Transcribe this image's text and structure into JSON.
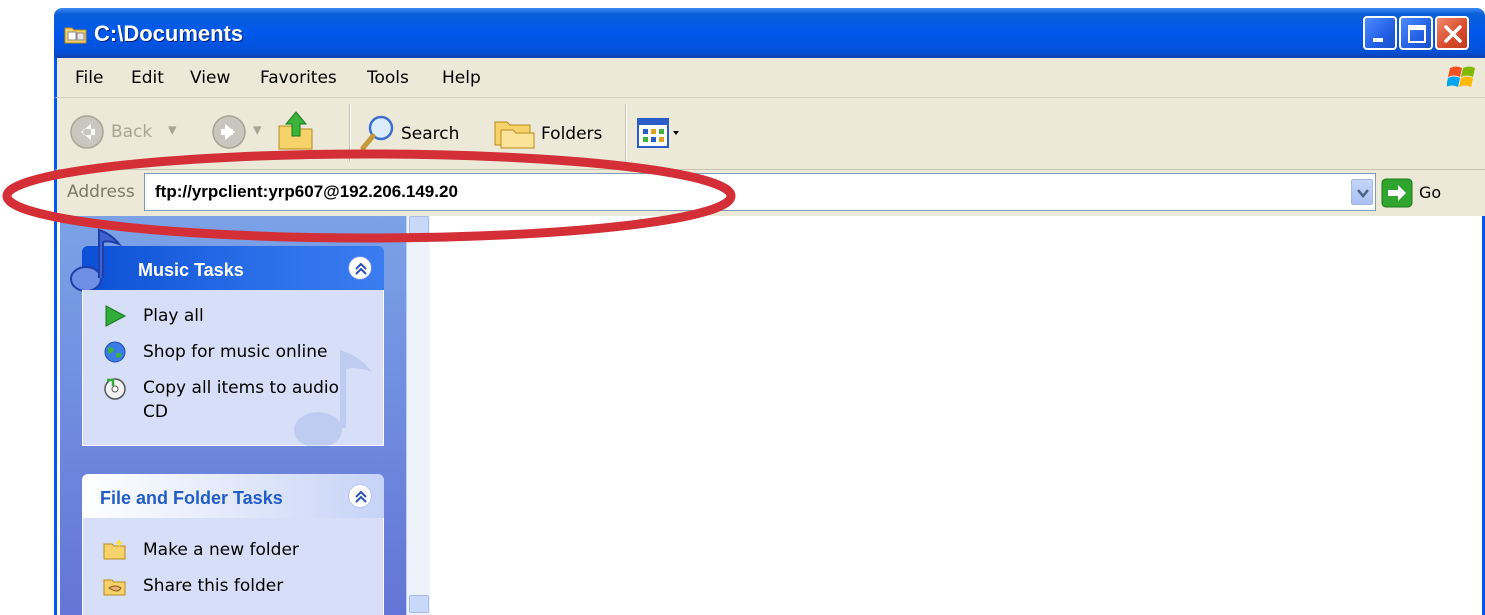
{
  "window": {
    "title": "C:\\Documents"
  },
  "menu": [
    "File",
    "Edit",
    "View",
    "Favorites",
    "Tools",
    "Help"
  ],
  "toolbar": {
    "back_label": "Back",
    "search_label": "Search",
    "folders_label": "Folders"
  },
  "address": {
    "label": "Address",
    "value": "ftp://yrpclient:yrp607@192.206.149.20",
    "go_label": "Go"
  },
  "music_tasks": {
    "title": "Music Tasks",
    "items": [
      {
        "label": "Play all",
        "icon": "play-icon"
      },
      {
        "label": "Shop for music online",
        "icon": "globe-icon"
      },
      {
        "label": "Copy all items to audio CD",
        "icon": "cd-copy-icon"
      }
    ]
  },
  "file_tasks": {
    "title": "File and Folder Tasks",
    "items": [
      {
        "label": "Make a new folder",
        "icon": "new-folder-icon"
      },
      {
        "label": "Share this folder",
        "icon": "share-folder-icon"
      }
    ]
  },
  "colors": {
    "xp_blue": "#0058ee",
    "highlight": "#d42e37",
    "panel_bg": "#d6dff7",
    "chrome": "#ece9d8"
  }
}
